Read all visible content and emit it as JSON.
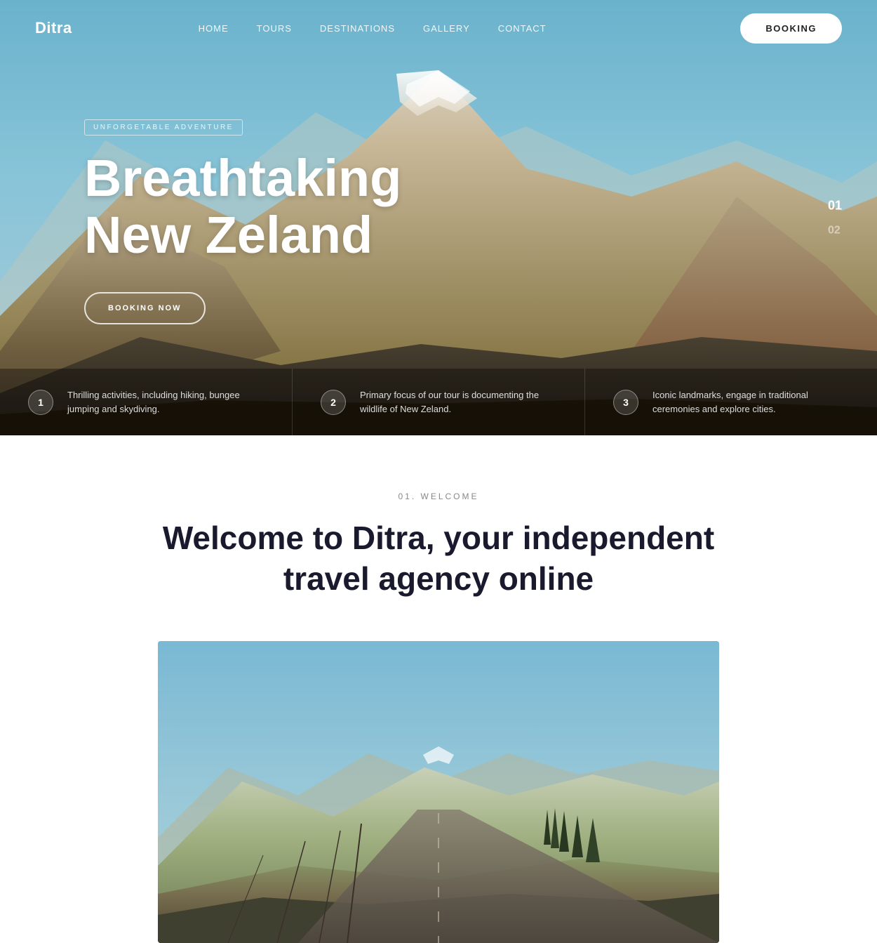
{
  "brand": {
    "name": "Ditra"
  },
  "nav": {
    "links": [
      {
        "label": "HOME",
        "id": "home"
      },
      {
        "label": "TOURS",
        "id": "tours"
      },
      {
        "label": "DESTINATIONS",
        "id": "destinations"
      },
      {
        "label": "GALLERY",
        "id": "gallery"
      },
      {
        "label": "CONTACT",
        "id": "contact"
      }
    ],
    "booking_label": "BOOKING"
  },
  "hero": {
    "badge": "UNFORGETABLE ADVENTURE",
    "title_line1": "Breathtaking",
    "title_line2": "New Zeland",
    "booking_now_label": "BOOKING NOW",
    "slide_active": "01",
    "slide_inactive": "02"
  },
  "features": [
    {
      "num": "1",
      "text": "Thrilling activities, including hiking, bungee jumping and skydiving."
    },
    {
      "num": "2",
      "text": "Primary focus of our tour is documenting the wildlife of New Zeland."
    },
    {
      "num": "3",
      "text": "Iconic landmarks, engage in traditional ceremonies and explore cities."
    }
  ],
  "welcome": {
    "label": "01. WELCOME",
    "title_line1": "Welcome to Ditra, your independent",
    "title_line2": "travel agency online"
  }
}
